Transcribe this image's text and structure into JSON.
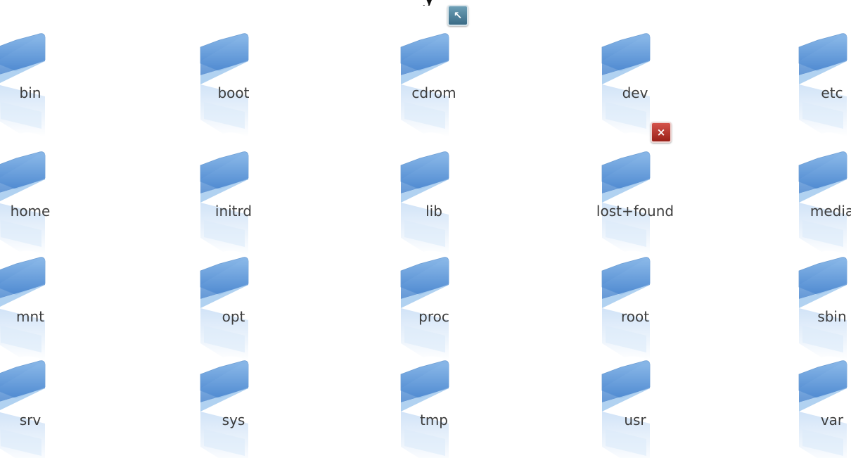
{
  "window": {
    "title_fragment": "y"
  },
  "folders": [
    {
      "name": "bin"
    },
    {
      "name": "boot"
    },
    {
      "name": "cdrom",
      "emblem": "link-emblem-icon"
    },
    {
      "name": "dev"
    },
    {
      "name": "etc"
    },
    {
      "name": "home"
    },
    {
      "name": "initrd"
    },
    {
      "name": "lib"
    },
    {
      "name": "lost+found",
      "emblem": "unreadable-emblem-icon"
    },
    {
      "name": "media"
    },
    {
      "name": "mnt"
    },
    {
      "name": "opt"
    },
    {
      "name": "proc"
    },
    {
      "name": "root"
    },
    {
      "name": "sbin"
    },
    {
      "name": "srv"
    },
    {
      "name": "sys"
    },
    {
      "name": "tmp"
    },
    {
      "name": "usr"
    },
    {
      "name": "var"
    }
  ],
  "emblems": {
    "link_symbol": "↖",
    "unreadable_symbol": "×"
  },
  "colors": {
    "folder_light": "#cfe2f7",
    "folder_mid": "#8ab8e8",
    "folder_dark": "#4a86cf",
    "link_emblem": "#3a6b86",
    "unreadable_emblem": "#b8352b",
    "label_text": "#3c3c3c"
  }
}
